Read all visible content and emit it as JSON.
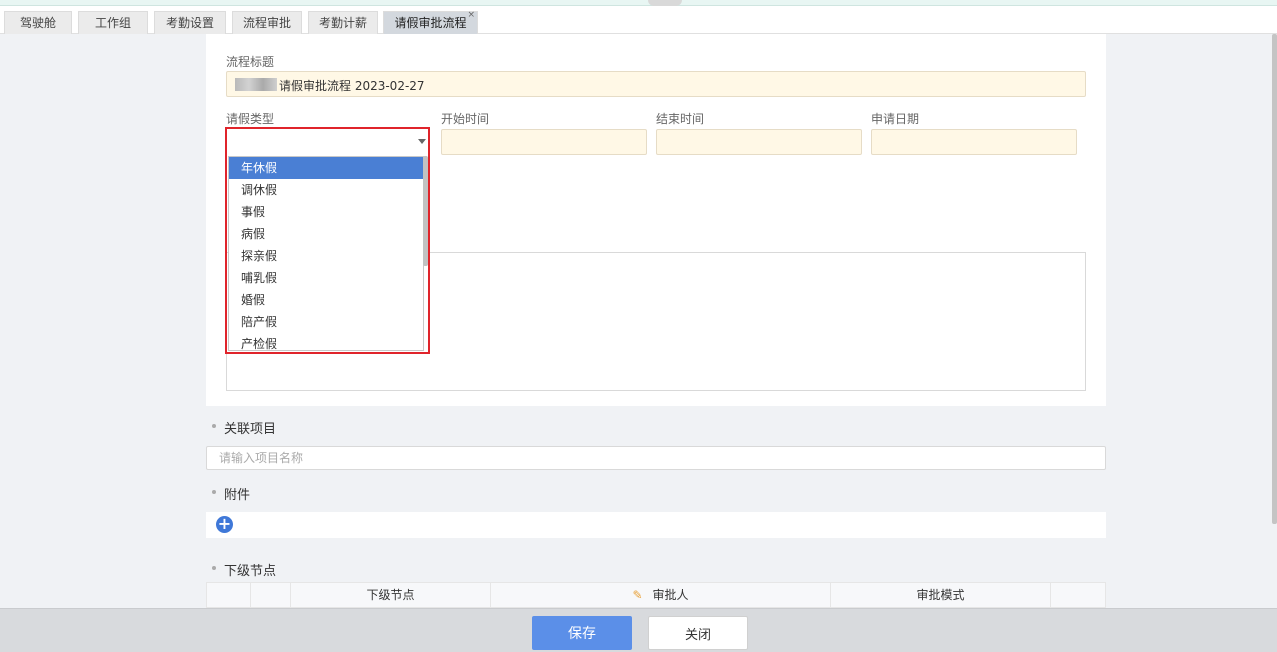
{
  "tabs": [
    {
      "label": "驾驶舱"
    },
    {
      "label": "工作组"
    },
    {
      "label": "考勤设置"
    },
    {
      "label": "流程审批"
    },
    {
      "label": "考勤计薪"
    },
    {
      "label": "请假审批流程",
      "active": true
    }
  ],
  "tab_close_glyph": "×",
  "form": {
    "title_label": "流程标题",
    "title_value": "请假审批流程 2023-02-27",
    "leave_type_label": "请假类型",
    "start_time_label": "开始时间",
    "end_time_label": "结束时间",
    "apply_date_label": "申请日期",
    "leave_type_value": "",
    "start_time_value": "",
    "end_time_value": "",
    "apply_date_value": ""
  },
  "leave_type_options": [
    "年休假",
    "调休假",
    "事假",
    "病假",
    "探亲假",
    "哺乳假",
    "婚假",
    "陪产假",
    "产检假"
  ],
  "leave_type_highlighted_index": 0,
  "related_project": {
    "title": "关联项目",
    "placeholder": "请输入项目名称"
  },
  "attachments": {
    "title": "附件",
    "add_glyph": "+"
  },
  "next_nodes": {
    "title": "下级节点",
    "columns": [
      "下级节点",
      "审批人",
      "审批模式"
    ],
    "pencil_glyph": "✎"
  },
  "footer": {
    "save_label": "保存",
    "close_label": "关闭"
  },
  "colors": {
    "primary": "#5b8fe8",
    "selected_option": "#4a7fd4",
    "highlight_border": "#e0242b",
    "field_background": "#fff8e6"
  },
  "icons": {
    "caret": "caret-down-icon",
    "add": "plus-circle-icon",
    "edit": "pencil-icon",
    "tab_close": "close-icon"
  }
}
